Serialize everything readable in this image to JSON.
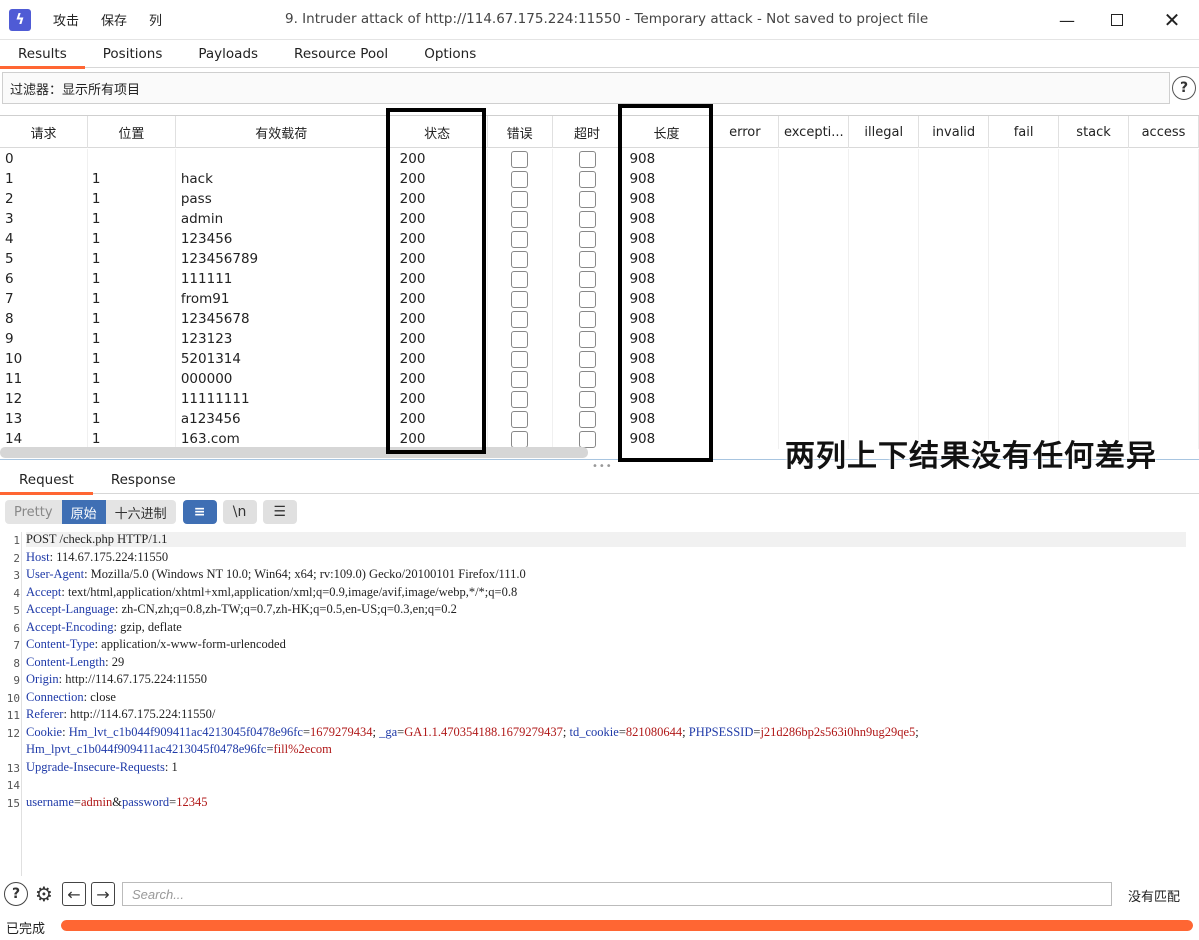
{
  "app": {
    "menu": [
      "攻击",
      "保存",
      "列"
    ],
    "window_title": "9. Intruder attack of http://114.67.175.224:11550 - Temporary attack - Not saved to project file"
  },
  "tabs": [
    {
      "label": "Results",
      "active": true
    },
    {
      "label": "Positions",
      "active": false
    },
    {
      "label": "Payloads",
      "active": false
    },
    {
      "label": "Resource Pool",
      "active": false
    },
    {
      "label": "Options",
      "active": false
    }
  ],
  "filter": {
    "text": "过滤器：显示所有项目"
  },
  "table": {
    "columns": [
      "请求",
      "位置",
      "有效载荷",
      "状态",
      "错误",
      "超时",
      "长度",
      "error",
      "excepti...",
      "illegal",
      "invalid",
      "fail",
      "stack",
      "access"
    ],
    "rows": [
      {
        "req": "0",
        "pos": "",
        "payload": "",
        "status": "200",
        "length": "908"
      },
      {
        "req": "1",
        "pos": "1",
        "payload": "hack",
        "status": "200",
        "length": "908"
      },
      {
        "req": "2",
        "pos": "1",
        "payload": "pass",
        "status": "200",
        "length": "908"
      },
      {
        "req": "3",
        "pos": "1",
        "payload": "admin",
        "status": "200",
        "length": "908"
      },
      {
        "req": "4",
        "pos": "1",
        "payload": "123456",
        "status": "200",
        "length": "908"
      },
      {
        "req": "5",
        "pos": "1",
        "payload": "123456789",
        "status": "200",
        "length": "908"
      },
      {
        "req": "6",
        "pos": "1",
        "payload": "111111",
        "status": "200",
        "length": "908"
      },
      {
        "req": "7",
        "pos": "1",
        "payload": "from91",
        "status": "200",
        "length": "908"
      },
      {
        "req": "8",
        "pos": "1",
        "payload": "12345678",
        "status": "200",
        "length": "908"
      },
      {
        "req": "9",
        "pos": "1",
        "payload": "123123",
        "status": "200",
        "length": "908"
      },
      {
        "req": "10",
        "pos": "1",
        "payload": "5201314",
        "status": "200",
        "length": "908"
      },
      {
        "req": "11",
        "pos": "1",
        "payload": "000000",
        "status": "200",
        "length": "908"
      },
      {
        "req": "12",
        "pos": "1",
        "payload": "11111111",
        "status": "200",
        "length": "908"
      },
      {
        "req": "13",
        "pos": "1",
        "payload": "a123456",
        "status": "200",
        "length": "908"
      },
      {
        "req": "14",
        "pos": "1",
        "payload": "163.com",
        "status": "200",
        "length": "908"
      }
    ]
  },
  "annotation": "两列上下结果没有任何差异",
  "detail_tabs": [
    {
      "label": "Request",
      "active": true
    },
    {
      "label": "Response",
      "active": false
    }
  ],
  "view_modes": [
    "Pretty",
    "原始",
    "十六进制"
  ],
  "request_lines": [
    {
      "n": "1",
      "parts": [
        {
          "t": "POST /check.php HTTP/1.1",
          "c": "p"
        }
      ]
    },
    {
      "n": "2",
      "parts": [
        {
          "t": "Host",
          "c": "k"
        },
        {
          "t": ": 114.67.175.224:11550",
          "c": "p"
        }
      ]
    },
    {
      "n": "3",
      "parts": [
        {
          "t": "User-Agent",
          "c": "k"
        },
        {
          "t": ": Mozilla/5.0 (Windows NT 10.0; Win64; x64; rv:109.0) Gecko/20100101 Firefox/111.0",
          "c": "p"
        }
      ]
    },
    {
      "n": "4",
      "parts": [
        {
          "t": "Accept",
          "c": "k"
        },
        {
          "t": ": text/html,application/xhtml+xml,application/xml;q=0.9,image/avif,image/webp,*/*;q=0.8",
          "c": "p"
        }
      ]
    },
    {
      "n": "5",
      "parts": [
        {
          "t": "Accept-Language",
          "c": "k"
        },
        {
          "t": ": zh-CN,zh;q=0.8,zh-TW;q=0.7,zh-HK;q=0.5,en-US;q=0.3,en;q=0.2",
          "c": "p"
        }
      ]
    },
    {
      "n": "6",
      "parts": [
        {
          "t": "Accept-Encoding",
          "c": "k"
        },
        {
          "t": ": gzip, deflate",
          "c": "p"
        }
      ]
    },
    {
      "n": "7",
      "parts": [
        {
          "t": "Content-Type",
          "c": "k"
        },
        {
          "t": ": application/x-www-form-urlencoded",
          "c": "p"
        }
      ]
    },
    {
      "n": "8",
      "parts": [
        {
          "t": "Content-Length",
          "c": "k"
        },
        {
          "t": ": 29",
          "c": "p"
        }
      ]
    },
    {
      "n": "9",
      "parts": [
        {
          "t": "Origin",
          "c": "k"
        },
        {
          "t": ": http://114.67.175.224:11550",
          "c": "p"
        }
      ]
    },
    {
      "n": "10",
      "parts": [
        {
          "t": "Connection",
          "c": "k"
        },
        {
          "t": ": close",
          "c": "p"
        }
      ]
    },
    {
      "n": "11",
      "parts": [
        {
          "t": "Referer",
          "c": "k"
        },
        {
          "t": ": http://114.67.175.224:11550/",
          "c": "p"
        }
      ]
    },
    {
      "n": "12",
      "parts": [
        {
          "t": "Cookie",
          "c": "k"
        },
        {
          "t": ": ",
          "c": "p"
        },
        {
          "t": "Hm_lvt_c1b044f909411ac4213045f0478e96fc",
          "c": "k"
        },
        {
          "t": "=",
          "c": "p"
        },
        {
          "t": "1679279434",
          "c": "v"
        },
        {
          "t": "; ",
          "c": "p"
        },
        {
          "t": "_ga",
          "c": "k"
        },
        {
          "t": "=",
          "c": "p"
        },
        {
          "t": "GA1.1.470354188.1679279437",
          "c": "v"
        },
        {
          "t": "; ",
          "c": "p"
        },
        {
          "t": "td_cookie",
          "c": "k"
        },
        {
          "t": "=",
          "c": "p"
        },
        {
          "t": "821080644",
          "c": "v"
        },
        {
          "t": "; ",
          "c": "p"
        },
        {
          "t": "PHPSESSID",
          "c": "k"
        },
        {
          "t": "=",
          "c": "p"
        },
        {
          "t": "j21d286bp2s563i0hn9ug29qe5",
          "c": "v"
        },
        {
          "t": ";",
          "c": "p"
        }
      ]
    },
    {
      "n": "",
      "parts": [
        {
          "t": "Hm_lpvt_c1b044f909411ac4213045f0478e96fc",
          "c": "k"
        },
        {
          "t": "=",
          "c": "p"
        },
        {
          "t": "fill%2ecom",
          "c": "v"
        }
      ]
    },
    {
      "n": "13",
      "parts": [
        {
          "t": "Upgrade-Insecure-Requests",
          "c": "k"
        },
        {
          "t": ": 1",
          "c": "p"
        }
      ]
    },
    {
      "n": "14",
      "parts": []
    },
    {
      "n": "15",
      "parts": [
        {
          "t": "username",
          "c": "k"
        },
        {
          "t": "=",
          "c": "p"
        },
        {
          "t": "admin",
          "c": "v"
        },
        {
          "t": "&",
          "c": "p"
        },
        {
          "t": "password",
          "c": "k"
        },
        {
          "t": "=",
          "c": "p"
        },
        {
          "t": "12345",
          "c": "v"
        }
      ]
    }
  ],
  "search": {
    "placeholder": "Search...",
    "result": "没有匹配"
  },
  "status": {
    "text": "已完成",
    "progress": 1.0
  },
  "colors": {
    "accent": "#ff6633",
    "selected": "#3f6fb4"
  }
}
